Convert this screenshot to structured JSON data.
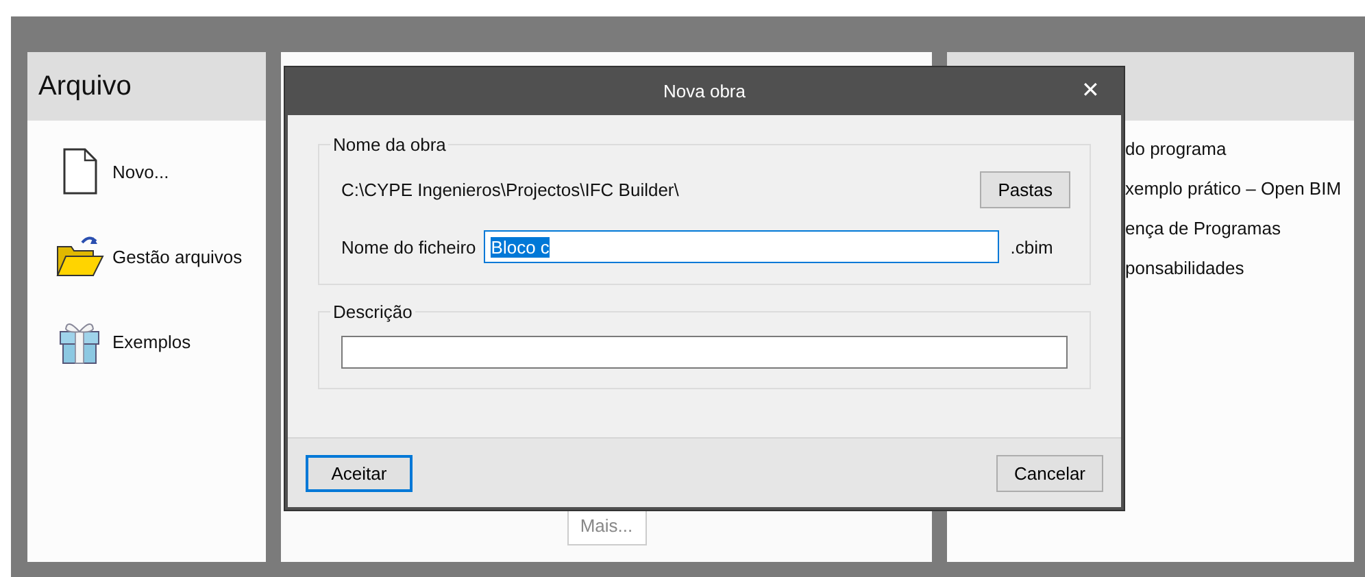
{
  "left_panel": {
    "title": "Arquivo",
    "items": [
      {
        "label": "Novo...",
        "kind": "new"
      },
      {
        "label": "Gestão arquivos",
        "kind": "manage"
      },
      {
        "label": "Exemplos",
        "kind": "examples"
      }
    ]
  },
  "middle_panel": {
    "more_button": "Mais..."
  },
  "right_panel": {
    "items": [
      "do programa",
      "xemplo prático – Open BIM",
      "ença de Programas",
      "ponsabilidades"
    ]
  },
  "dialog": {
    "title": "Nova obra",
    "close": "✕",
    "name_group": {
      "legend": "Nome da obra",
      "path": "C:\\CYPE Ingenieros\\Projectos\\IFC Builder\\",
      "folders_button": "Pastas",
      "file_label": "Nome do ficheiro",
      "file_value": "Bloco c",
      "file_value_selected": true,
      "extension": ".cbim"
    },
    "description_group": {
      "legend": "Descrição"
    },
    "buttons": [
      {
        "label": "Aceitar",
        "focused": true
      },
      {
        "label": "Cancelar",
        "focused": false
      }
    ]
  }
}
